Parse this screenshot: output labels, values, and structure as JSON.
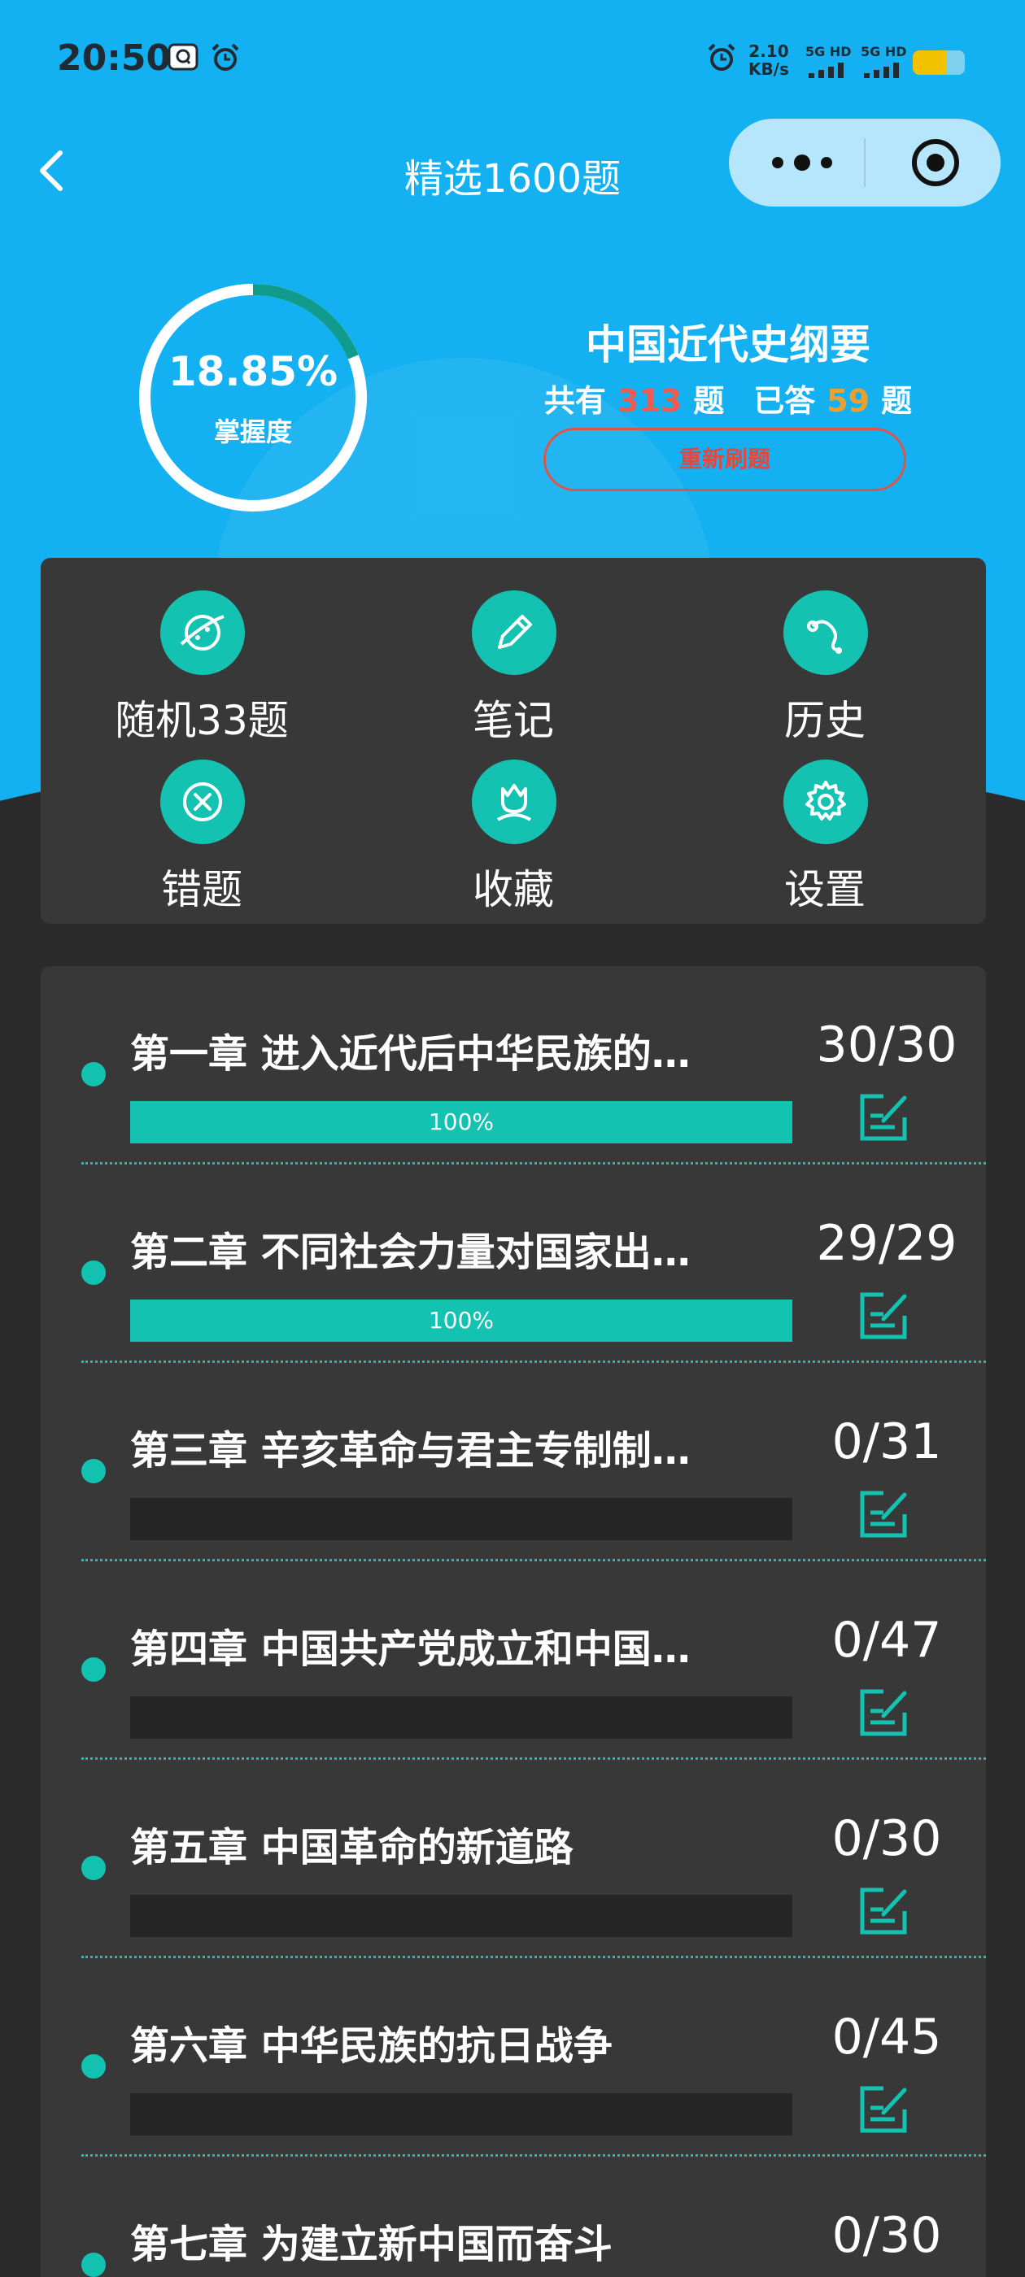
{
  "status_bar": {
    "time": "20:50",
    "net_speed_value": "2.10",
    "net_speed_unit": "KB/s",
    "sim1_label": "5G HD",
    "sim2_label": "5G HD",
    "icons": [
      "app-notification-icon",
      "alarm-icon",
      "alarm-icon",
      "signal-icon",
      "battery-icon"
    ]
  },
  "nav": {
    "title": "精选1600题",
    "back_icon": "chevron-left-icon",
    "more_icon": "more-dots-icon",
    "close_icon": "target-icon"
  },
  "progress": {
    "percent_text": "18.85%",
    "label": "掌握度",
    "fraction": 0.1885
  },
  "subject": {
    "title": "中国近代史纲要",
    "total_prefix": "共有",
    "total_count": "313",
    "total_suffix": "题",
    "answered_prefix": "已答",
    "answered_count": "59",
    "answered_suffix": "题",
    "redo_label": "重新刷题"
  },
  "menu": [
    {
      "label": "随机33题",
      "icon": "planet-icon"
    },
    {
      "label": "笔记",
      "icon": "pencil-icon"
    },
    {
      "label": "历史",
      "icon": "history-icon"
    },
    {
      "label": "错题",
      "icon": "close-circle-icon"
    },
    {
      "label": "收藏",
      "icon": "tulip-icon"
    },
    {
      "label": "设置",
      "icon": "gear-icon"
    }
  ],
  "chapters": [
    {
      "title": "第一章 进入近代后中华民族的…",
      "count": "30/30",
      "progress": 1.0,
      "percent_label": "100%"
    },
    {
      "title": "第二章 不同社会力量对国家出…",
      "count": "29/29",
      "progress": 1.0,
      "percent_label": "100%"
    },
    {
      "title": "第三章 辛亥革命与君主专制制…",
      "count": "0/31",
      "progress": 0,
      "percent_label": ""
    },
    {
      "title": "第四章 中国共产党成立和中国…",
      "count": "0/47",
      "progress": 0,
      "percent_label": ""
    },
    {
      "title": "第五章 中国革命的新道路",
      "count": "0/30",
      "progress": 0,
      "percent_label": ""
    },
    {
      "title": "第六章 中华民族的抗日战争",
      "count": "0/45",
      "progress": 0,
      "percent_label": ""
    },
    {
      "title": "第七章 为建立新中国而奋斗",
      "count": "0/30",
      "progress": 0,
      "percent_label": ""
    }
  ],
  "colors": {
    "hero": "#13b0f2",
    "accent": "#13c2b0",
    "card": "#383838",
    "background": "#2b2b2b",
    "total_count": "#f25a4f",
    "answered_count": "#f0a02a"
  }
}
